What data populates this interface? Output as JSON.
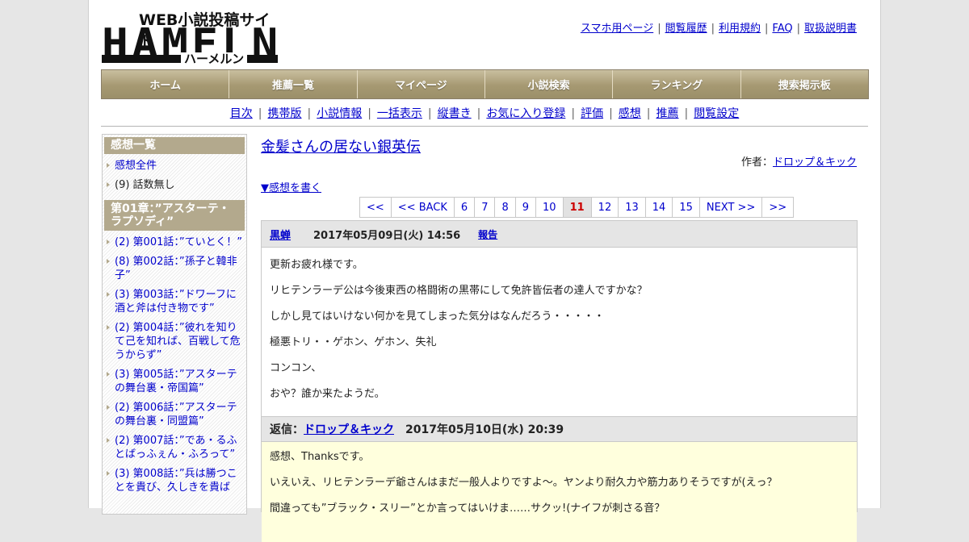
{
  "header": {
    "logo_tagline": "WEB小説投稿サイト",
    "logo_main": "HAMELN",
    "logo_kana": "ハーメルン",
    "links": [
      "スマホ用ページ",
      "閲覧履歴",
      "利用規約",
      "FAQ",
      "取扱説明書"
    ]
  },
  "nav": [
    "ホーム",
    "推薦一覧",
    "マイページ",
    "小説検索",
    "ランキング",
    "捜索掲示板"
  ],
  "subnav": [
    "目次",
    "携帯版",
    "小説情報",
    "一括表示",
    "縦書き",
    "お気に入り登録",
    "評価",
    "感想",
    "推薦",
    "閲覧設定"
  ],
  "sidebar": {
    "heading": "感想一覧",
    "all_link": "感想全件",
    "no_episode": "(9) 話数無し",
    "chapter": "第01章：”アスターテ・ラプソディ”",
    "episodes": [
      "(2) 第001話：”ていとく！”",
      "(8) 第002話：”孫子と韓非子”",
      "(3) 第003話：”ドワーフに酒と斧は付き物です”",
      "(2) 第004話：”彼れを知りて己を知れば、百戦して危うからず”",
      "(3) 第005話：”アスターテの舞台裏・帝国篇”",
      "(2) 第006話：”アスターテの舞台裏・同盟篇”",
      "(2) 第007話：”であ・るふとばっふぇん・ふろって”",
      "(3) 第008話：”兵は勝つことを貴び、久しきを貴ば"
    ]
  },
  "novel": {
    "title": "金髪さんの居ない銀英伝",
    "author_label": "作者：",
    "author": "ドロップ＆キック",
    "write_link": "▼感想を書く"
  },
  "pager": {
    "first": "<<",
    "back": "<< BACK",
    "pages": [
      "6",
      "7",
      "8",
      "9",
      "10"
    ],
    "current": "11",
    "pages_after": [
      "12",
      "13",
      "14",
      "15"
    ],
    "next": "NEXT >>",
    "last": ">>"
  },
  "comment": {
    "user": "黒蝉",
    "date": "2017年05月09日(火) 14:56",
    "report": "報告",
    "lines": [
      "更新お疲れ様です。",
      "リヒテンラーデ公は今後東西の格闘術の黒帯にして免許皆伝者の達人ですかな？",
      "しかし見てはいけない何かを見てしまった気分はなんだろう・・・・・",
      "極悪トリ・・ゲホン、ゲホン、失礼",
      "コンコン、",
      "おや？誰か来たようだ。"
    ]
  },
  "reply": {
    "label": "返信：",
    "user": "ドロップ＆キック",
    "date": "2017年05月10日(水) 20:39",
    "lines": [
      "感想、Thanksです。",
      "いえいえ、リヒテンラーデ爺さんはまだ一般人よりですよ～。ヤンより耐久力や筋力ありそうですが(えっ？",
      "間違っても”ブラック・スリー”とか言ってはいけま……サクッ!(ナイフが刺さる音？"
    ]
  },
  "colors": {
    "nav_gold": "#a69972",
    "sidebar_head": "#b3a98d",
    "reply_bg": "#ffffdd",
    "current_page": "#cc0000"
  }
}
